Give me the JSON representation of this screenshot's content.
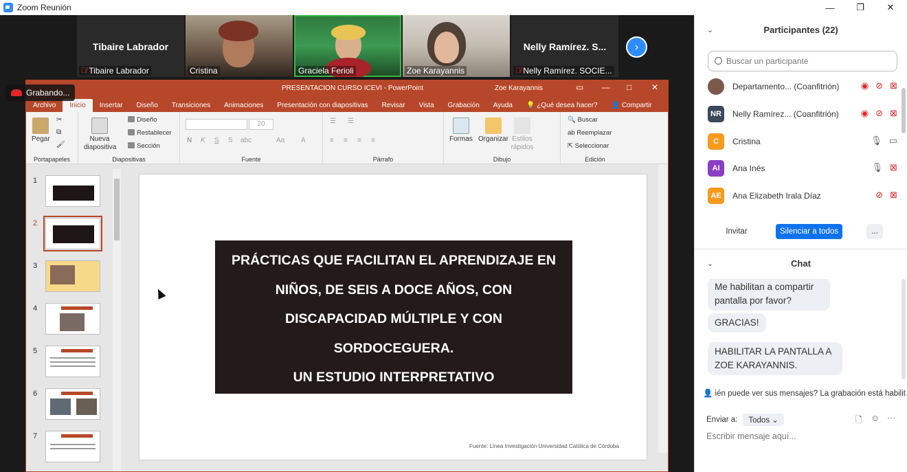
{
  "window": {
    "title": "Zoom Reunión",
    "controls": {
      "minimize": "—",
      "maximize": "❐",
      "close": "✕"
    }
  },
  "gallery": {
    "tiles": [
      {
        "big_name": "Tibaire Labrador",
        "label": "Tibaire Labrador",
        "muted": true,
        "video": false
      },
      {
        "label": "Cristina",
        "muted": false,
        "video": true
      },
      {
        "label": "Graciela Ferioli",
        "muted": false,
        "video": true,
        "active_speaker": true
      },
      {
        "label": "Zoe Karayannis",
        "muted": false,
        "video": true
      },
      {
        "big_name": "Nelly  Ramírez. S...",
        "label": "Nelly Ramírez. SOCIE...",
        "muted": true,
        "video": false
      }
    ],
    "next_icon": "›"
  },
  "recording": {
    "label": "Grabando..."
  },
  "ppt": {
    "document_title": "PRESENTACION CURSO ICEVI  -  PowerPoint",
    "user": "Zoe Karayannis",
    "tabs": [
      "Archivo",
      "Inicio",
      "Insertar",
      "Diseño",
      "Transiciones",
      "Animaciones",
      "Presentación con diapositivas",
      "Revisar",
      "Vista",
      "Grabación",
      "Ayuda"
    ],
    "active_tab": "Inicio",
    "tell_me": "¿Qué desea hacer?",
    "share": "Compartir",
    "ribbon": {
      "portapapeles": {
        "label": "Portapapeles",
        "paste": "Pegar"
      },
      "diapositivas": {
        "label": "Diapositivas",
        "new_slide": "Nueva diapositiva",
        "layout": "Diseño",
        "reset": "Restablecer",
        "section": "Sección"
      },
      "fuente": {
        "label": "Fuente",
        "font_size": "20"
      },
      "parrafo": {
        "label": "Párrafo"
      },
      "dibujo": {
        "label": "Dibujo",
        "shapes": "Formas",
        "arrange": "Organizar",
        "quick_styles": "Estilos rápidos"
      },
      "edicion": {
        "label": "Edición",
        "find": "Buscar",
        "replace": "Reemplazar",
        "select": "Seleccionar"
      }
    },
    "thumbnails": [
      "1",
      "2",
      "3",
      "4",
      "5",
      "6",
      "7"
    ],
    "selected_slide": "2",
    "slide": {
      "lines": [
        "PRÁCTICAS  QUE FACILITAN EL APRENDIZAJE EN",
        "NIÑOS, DE SEIS A DOCE AÑOS, CON",
        "DISCAPACIDAD MÚLTIPLE Y CON",
        "SORDOCEGUERA.",
        "UN ESTUDIO INTERPRETATIVO"
      ],
      "footer": "Fuente: Línea Investigación Universidad Católica de Córdoba"
    }
  },
  "participants": {
    "title": "Participantes (22)",
    "search_placeholder": "Buscar un participante",
    "list": [
      {
        "initials": "",
        "name": "Departamento...",
        "role": "(Coanfitrión)",
        "color": "#7b5a4a",
        "mic": "muted",
        "video": "off",
        "recording": true
      },
      {
        "initials": "NR",
        "name": "Nelly Ramírez...",
        "role": "(Coanfitrión)",
        "color": "#3a4a5c",
        "mic": "muted",
        "video": "off",
        "recording": true
      },
      {
        "initials": "C",
        "name": "Cristina",
        "role": "",
        "color": "#f79a1e",
        "mic": "on",
        "video": "on",
        "recording": false
      },
      {
        "initials": "AI",
        "name": "Ana Inés",
        "role": "",
        "color": "#8a3ec4",
        "mic": "on",
        "video": "off",
        "recording": false
      },
      {
        "initials": "AE",
        "name": "Ana Elizabeth Irala Díaz",
        "role": "",
        "color": "#f79a1e",
        "mic": "muted",
        "video": "off",
        "recording": false
      }
    ],
    "buttons": {
      "invite": "Invitar",
      "mute_all": "Silenciar a todos",
      "more": "..."
    }
  },
  "chat": {
    "title": "Chat",
    "messages": [
      "Me habilitan a compartir pantalla por favor?",
      "GRACIAS!",
      "HABILITAR LA PANTALLA A ZOE KARAYANNIS."
    ],
    "notice": "ién puede ver sus mensajes? La grabación está habilit",
    "send_to_label": "Enviar a:",
    "send_to_value": "Todos",
    "composer_placeholder": "Escribir mensaje aquí..."
  },
  "colors": {
    "zoom_blue": "#2d8cff",
    "ppt_red": "#b7472a",
    "muted_red": "#e02828"
  }
}
